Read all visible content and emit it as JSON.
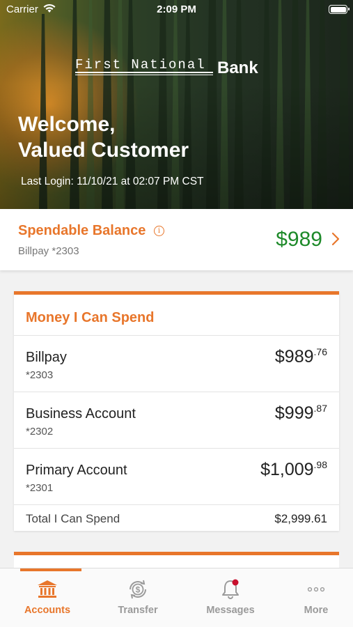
{
  "status_bar": {
    "carrier": "Carrier",
    "time": "2:09 PM"
  },
  "header": {
    "logo_first": "First National",
    "logo_bank": "Bank",
    "welcome_line1": "Welcome,",
    "welcome_line2": "Valued Customer",
    "last_login": "Last Login: 11/10/21 at 02:07 PM CST"
  },
  "spendable": {
    "title": "Spendable Balance",
    "info_glyph": "i",
    "account": "Billpay *2303",
    "amount": "$989"
  },
  "money_card": {
    "title": "Money I Can Spend",
    "accounts": [
      {
        "name": "Billpay",
        "number": "*2303",
        "dollars": "$989",
        "cents": ".76"
      },
      {
        "name": "Business Account",
        "number": "*2302",
        "dollars": "$999",
        "cents": ".87"
      },
      {
        "name": "Primary Account",
        "number": "*2301",
        "dollars": "$1,009",
        "cents": ".98"
      }
    ],
    "total_label": "Total I Can Spend",
    "total_value": "$2,999.61"
  },
  "tabs": [
    {
      "label": "Accounts",
      "icon": "bank-icon",
      "active": true
    },
    {
      "label": "Transfer",
      "icon": "transfer-icon",
      "active": false
    },
    {
      "label": "Messages",
      "icon": "bell-icon",
      "active": false
    },
    {
      "label": "More",
      "icon": "more-icon",
      "active": false
    }
  ],
  "colors": {
    "accent": "#e8762b",
    "balance_green": "#1e8a2a",
    "notification_dot": "#c8102e"
  }
}
